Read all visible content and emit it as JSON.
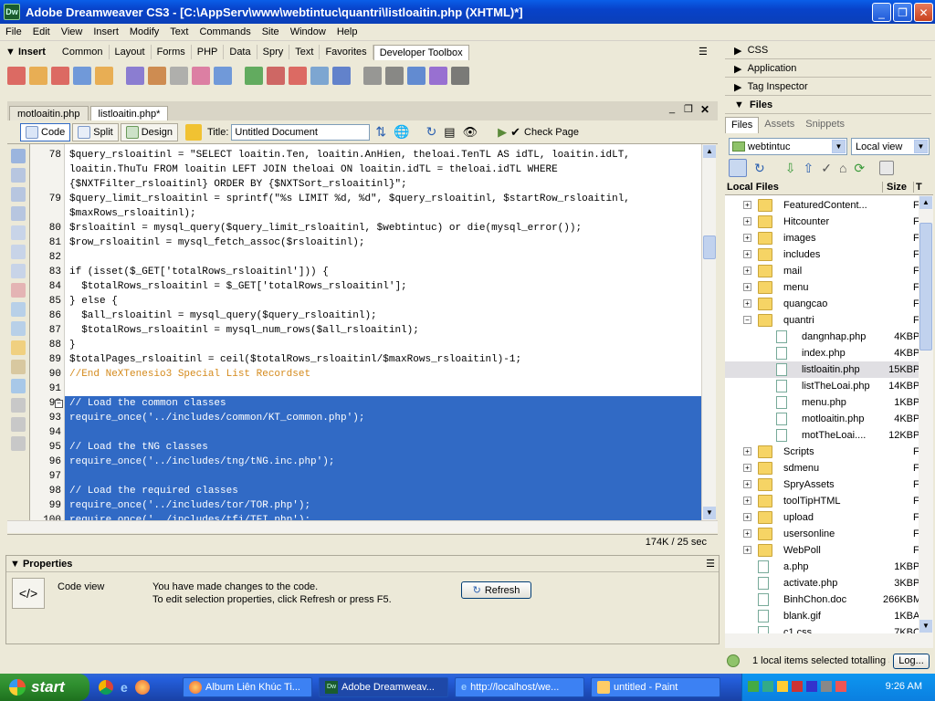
{
  "window": {
    "title": "Adobe Dreamweaver CS3 - [C:\\AppServ\\www\\webtintuc\\quantri\\listloaitin.php (XHTML)*]",
    "icon_label": "Dw"
  },
  "menu": [
    "File",
    "Edit",
    "View",
    "Insert",
    "Modify",
    "Text",
    "Commands",
    "Site",
    "Window",
    "Help"
  ],
  "insert_bar": {
    "label": "Insert",
    "tabs": [
      "Common",
      "Layout",
      "Forms",
      "PHP",
      "Data",
      "Spry",
      "Text",
      "Favorites",
      "Developer Toolbox"
    ],
    "active": "Developer Toolbox"
  },
  "doc_tabs": [
    "motloaitin.php",
    "listloaitin.php*"
  ],
  "doc_toolbar": {
    "code": "Code",
    "split": "Split",
    "design": "Design",
    "title_label": "Title:",
    "title_value": "Untitled Document",
    "check_page": "Check Page"
  },
  "code_lines": [
    {
      "n": "78",
      "t": "$query_rsloaitinl = \"SELECT loaitin.Ten, loaitin.AnHien, theloai.TenTL AS idTL, loaitin.idLT,"
    },
    {
      "n": "",
      "t": "loaitin.ThuTu FROM loaitin LEFT JOIN theloai ON loaitin.idTL = theloai.idTL WHERE"
    },
    {
      "n": "",
      "t": "{$NXTFilter_rsloaitinl} ORDER BY {$NXTSort_rsloaitinl}\";"
    },
    {
      "n": "79",
      "t": "$query_limit_rsloaitinl = sprintf(\"%s LIMIT %d, %d\", $query_rsloaitinl, $startRow_rsloaitinl,"
    },
    {
      "n": "",
      "t": "$maxRows_rsloaitinl);"
    },
    {
      "n": "80",
      "t": "$rsloaitinl = mysql_query($query_limit_rsloaitinl, $webtintuc) or die(mysql_error());"
    },
    {
      "n": "81",
      "t": "$row_rsloaitinl = mysql_fetch_assoc($rsloaitinl);"
    },
    {
      "n": "82",
      "t": ""
    },
    {
      "n": "83",
      "t": "if (isset($_GET['totalRows_rsloaitinl'])) {"
    },
    {
      "n": "84",
      "t": "  $totalRows_rsloaitinl = $_GET['totalRows_rsloaitinl'];"
    },
    {
      "n": "85",
      "t": "} else {"
    },
    {
      "n": "86",
      "t": "  $all_rsloaitinl = mysql_query($query_rsloaitinl);"
    },
    {
      "n": "87",
      "t": "  $totalRows_rsloaitinl = mysql_num_rows($all_rsloaitinl);"
    },
    {
      "n": "88",
      "t": "}"
    },
    {
      "n": "89",
      "t": "$totalPages_rsloaitinl = ceil($totalRows_rsloaitinl/$maxRows_rsloaitinl)-1;"
    },
    {
      "n": "90",
      "t": "//End NeXTenesio3 Special List Recordset"
    },
    {
      "n": "91",
      "t": ""
    },
    {
      "n": "92",
      "t": "// Load the common classes"
    },
    {
      "n": "93",
      "t": "require_once('../includes/common/KT_common.php');"
    },
    {
      "n": "94",
      "t": ""
    },
    {
      "n": "95",
      "t": "// Load the tNG classes"
    },
    {
      "n": "96",
      "t": "require_once('../includes/tng/tNG.inc.php');"
    },
    {
      "n": "97",
      "t": ""
    },
    {
      "n": "98",
      "t": "// Load the required classes"
    },
    {
      "n": "99",
      "t": "require_once('../includes/tor/TOR.php');"
    },
    {
      "n": "100",
      "t": "require_once('../includes/tfi/TFI.php');"
    }
  ],
  "status": {
    "size": "174K / 25 sec"
  },
  "properties": {
    "header": "Properties",
    "view_label": "Code view",
    "msg1": "You have made changes to the code.",
    "msg2": "To edit selection properties, click Refresh or press F5.",
    "refresh": "Refresh"
  },
  "right_panels": {
    "css": "CSS",
    "application": "Application",
    "tag_inspector": "Tag Inspector",
    "files": "Files"
  },
  "files_tabs": [
    "Files",
    "Assets",
    "Snippets"
  ],
  "site": "webtintuc",
  "view": "Local view",
  "file_header": {
    "name": "Local Files",
    "size": "Size",
    "type": "T"
  },
  "files": [
    {
      "name": "FeaturedContent...",
      "size": "",
      "type": "F",
      "indent": 1,
      "kind": "folder",
      "tog": "+"
    },
    {
      "name": "Hitcounter",
      "size": "",
      "type": "F",
      "indent": 1,
      "kind": "folder",
      "tog": "+"
    },
    {
      "name": "images",
      "size": "",
      "type": "F",
      "indent": 1,
      "kind": "folder",
      "tog": "+"
    },
    {
      "name": "includes",
      "size": "",
      "type": "F",
      "indent": 1,
      "kind": "folder",
      "tog": "+"
    },
    {
      "name": "mail",
      "size": "",
      "type": "F",
      "indent": 1,
      "kind": "folder",
      "tog": "+"
    },
    {
      "name": "menu",
      "size": "",
      "type": "F",
      "indent": 1,
      "kind": "folder",
      "tog": "+"
    },
    {
      "name": "quangcao",
      "size": "",
      "type": "F",
      "indent": 1,
      "kind": "folder",
      "tog": "+"
    },
    {
      "name": "quantri",
      "size": "",
      "type": "F",
      "indent": 1,
      "kind": "folder",
      "tog": "-"
    },
    {
      "name": "dangnhap.php",
      "size": "4KB",
      "type": "P",
      "indent": 2,
      "kind": "php",
      "tog": ""
    },
    {
      "name": "index.php",
      "size": "4KB",
      "type": "P",
      "indent": 2,
      "kind": "php",
      "tog": ""
    },
    {
      "name": "listloaitin.php",
      "size": "15KB",
      "type": "P",
      "indent": 2,
      "kind": "php",
      "tog": "",
      "selected": true
    },
    {
      "name": "listTheLoai.php",
      "size": "14KB",
      "type": "P",
      "indent": 2,
      "kind": "php",
      "tog": ""
    },
    {
      "name": "menu.php",
      "size": "1KB",
      "type": "P",
      "indent": 2,
      "kind": "php",
      "tog": ""
    },
    {
      "name": "motloaitin.php",
      "size": "4KB",
      "type": "P",
      "indent": 2,
      "kind": "php",
      "tog": ""
    },
    {
      "name": "motTheLoai....",
      "size": "12KB",
      "type": "P",
      "indent": 2,
      "kind": "php",
      "tog": ""
    },
    {
      "name": "Scripts",
      "size": "",
      "type": "F",
      "indent": 1,
      "kind": "folder",
      "tog": "+"
    },
    {
      "name": "sdmenu",
      "size": "",
      "type": "F",
      "indent": 1,
      "kind": "folder",
      "tog": "+"
    },
    {
      "name": "SpryAssets",
      "size": "",
      "type": "F",
      "indent": 1,
      "kind": "folder",
      "tog": "+"
    },
    {
      "name": "toolTipHTML",
      "size": "",
      "type": "F",
      "indent": 1,
      "kind": "folder",
      "tog": "+"
    },
    {
      "name": "upload",
      "size": "",
      "type": "F",
      "indent": 1,
      "kind": "folder",
      "tog": "+"
    },
    {
      "name": "usersonline",
      "size": "",
      "type": "F",
      "indent": 1,
      "kind": "folder",
      "tog": "+"
    },
    {
      "name": "WebPoll",
      "size": "",
      "type": "F",
      "indent": 1,
      "kind": "folder",
      "tog": "+"
    },
    {
      "name": "a.php",
      "size": "1KB",
      "type": "P",
      "indent": 1,
      "kind": "php",
      "tog": ""
    },
    {
      "name": "activate.php",
      "size": "3KB",
      "type": "P",
      "indent": 1,
      "kind": "php",
      "tog": ""
    },
    {
      "name": "BinhChon.doc",
      "size": "266KB",
      "type": "M",
      "indent": 1,
      "kind": "doc",
      "tog": ""
    },
    {
      "name": "blank.gif",
      "size": "1KB",
      "type": "A",
      "indent": 1,
      "kind": "gif",
      "tog": ""
    },
    {
      "name": "c1.css",
      "size": "7KB",
      "type": "C",
      "indent": 1,
      "kind": "php",
      "tog": ""
    }
  ],
  "files_status": {
    "text": "1 local items selected totalling 3",
    "log": "Log..."
  },
  "taskbar": {
    "start": "start",
    "tasks": [
      "Album Liên Khúc Ti...",
      "Adobe Dreamweav...",
      "http://localhost/we...",
      "untitled - Paint"
    ],
    "clock": "9:26 AM"
  }
}
